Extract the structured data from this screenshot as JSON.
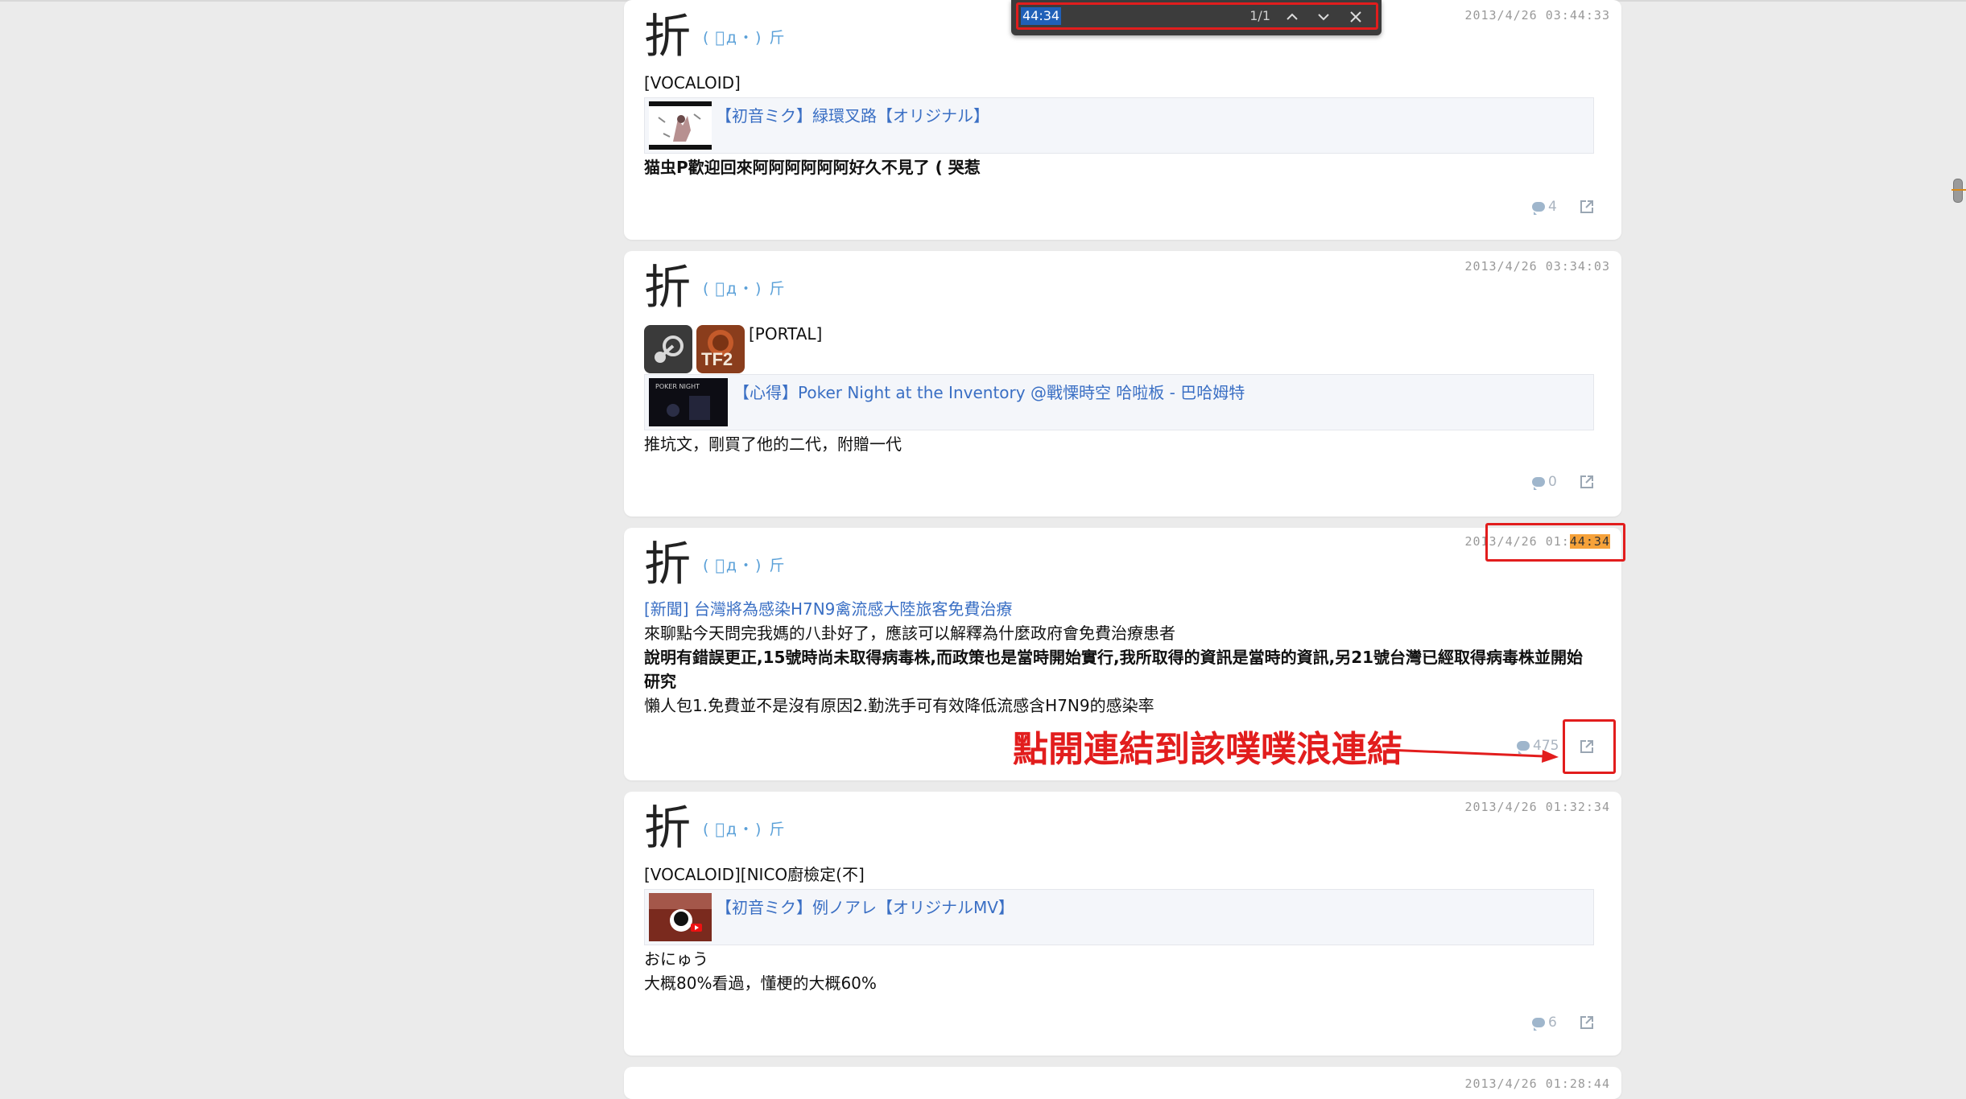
{
  "find_bar": {
    "query": "44:34",
    "count": "1/1"
  },
  "annotation": "點開連結到該噗噗浪連結",
  "posts": [
    {
      "avatar_char": "折",
      "nick": "( ﾟд・) 斤",
      "timestamp": "2013/4/26 03:44:33",
      "tag": "[VOCALOID]",
      "link_title": "【初音ミク】緑環叉路【オリジナル】",
      "body": "猫虫P歡迎回來阿阿阿阿阿阿好久不見了 ( 哭惹",
      "comments": "4"
    },
    {
      "avatar_char": "折",
      "nick": "( ﾟд・) 斤",
      "timestamp": "2013/4/26 03:34:03",
      "tag": "[PORTAL]",
      "badge_label": "TF2",
      "link_title": "【心得】Poker Night at the Inventory @戰慄時空 哈啦板 - 巴哈姆特",
      "thumb_caption": "POKER NIGHT",
      "body": "推坑文，剛買了他的二代，附贈一代",
      "comments": "0"
    },
    {
      "avatar_char": "折",
      "nick": "( ﾟд・) 斤",
      "timestamp_prefix": "2013/4/26 01:",
      "timestamp_highlight": "44:34",
      "news_link": "[新聞] 台灣將為感染H7N9禽流感大陸旅客免費治療",
      "line1": "來聊點今天問完我媽的八卦好了，應該可以解釋為什麼政府會免費治療患者",
      "line2": "說明有錯誤更正,15號時尚未取得病毒株,而政策也是當時開始實行,我所取得的資訊是當時的資訊,另21號台灣已經取得病毒株並開始研究",
      "line3": "懶人包1.免費並不是沒有原因2.勤洗手可有效降低流感含H7N9的感染率",
      "comments": "475"
    },
    {
      "avatar_char": "折",
      "nick": "( ﾟд・) 斤",
      "timestamp": "2013/4/26 01:32:34",
      "tag": "[VOCALOID][NICO廚檢定(不]",
      "link_title": "【初音ミク】例ノアレ【オリジナルMV】",
      "line1": "おにゅう",
      "line2": "大概80%看過，懂梗的大概60%",
      "comments": "6"
    },
    {
      "timestamp": "2013/4/26 01:28:44"
    }
  ]
}
